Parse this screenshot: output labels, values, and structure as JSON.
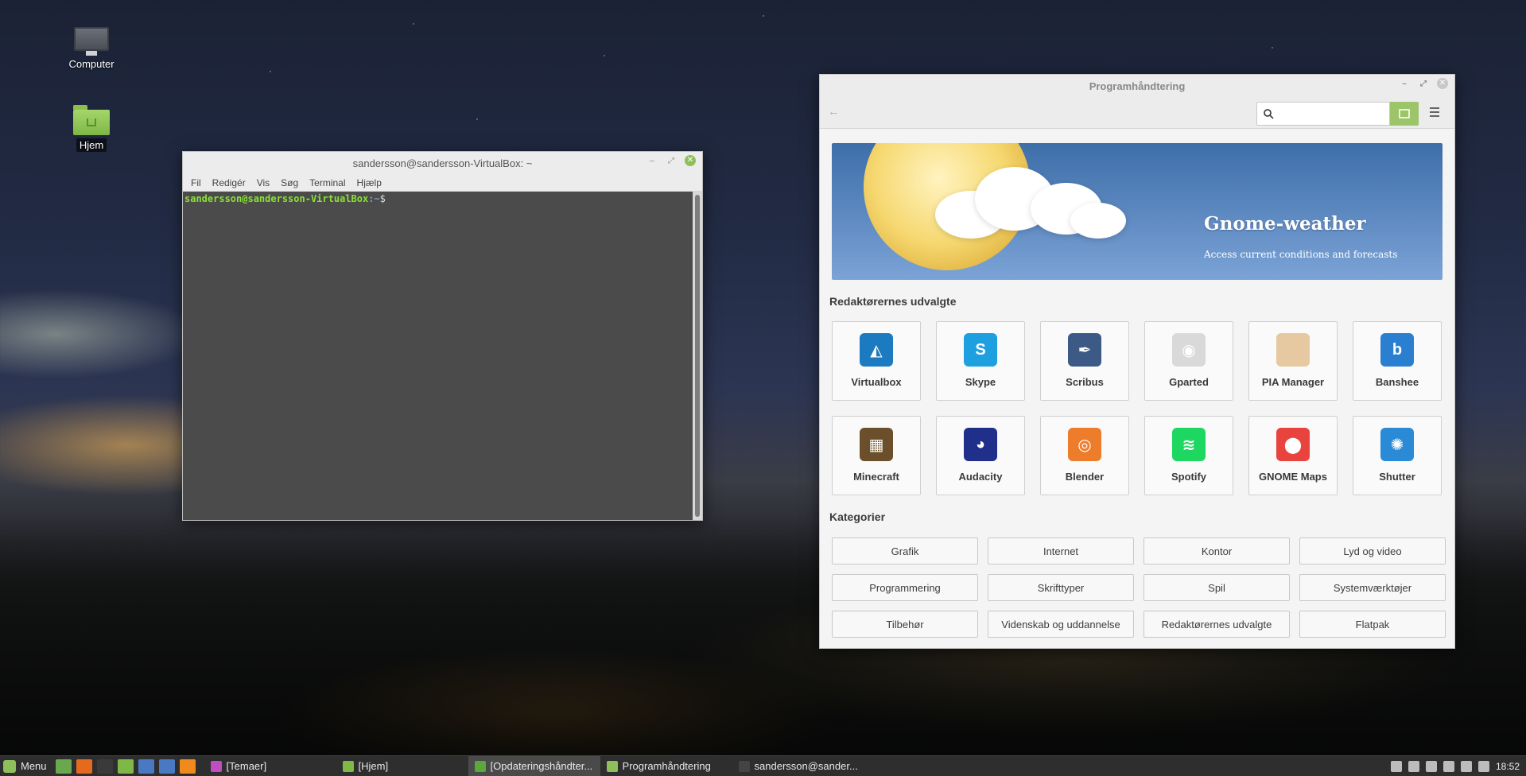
{
  "desktop": {
    "icons": [
      {
        "label": "Computer"
      },
      {
        "label": "Hjem"
      }
    ]
  },
  "terminal": {
    "title": "sandersson@sandersson-VirtualBox: ~",
    "menu": [
      "Fil",
      "Redigér",
      "Vis",
      "Søg",
      "Terminal",
      "Hjælp"
    ],
    "prompt_user": "sandersson@sandersson-VirtualBox",
    "prompt_path": ":~",
    "prompt_symbol": "$"
  },
  "swmgr": {
    "title": "Programhåndtering",
    "search_value": "",
    "banner": {
      "title": "Gnome-weather",
      "subtitle": "Access current conditions and forecasts"
    },
    "featured_title": "Redaktørernes udvalgte",
    "apps": [
      {
        "name": "Virtualbox",
        "color": "#1c7bc0",
        "glyph": "◭"
      },
      {
        "name": "Skype",
        "color": "#1ea0e0",
        "glyph": "S"
      },
      {
        "name": "Scribus",
        "color": "#3d5a87",
        "glyph": "✒"
      },
      {
        "name": "Gparted",
        "color": "#d9d9d9",
        "glyph": "◉"
      },
      {
        "name": "PIA Manager",
        "color": "#e6c9a0",
        "glyph": ""
      },
      {
        "name": "Banshee",
        "color": "#2b7fd1",
        "glyph": "b"
      },
      {
        "name": "Minecraft",
        "color": "#6b4f2a",
        "glyph": "▦"
      },
      {
        "name": "Audacity",
        "color": "#1f2f8a",
        "glyph": "◕"
      },
      {
        "name": "Blender",
        "color": "#ee7d2b",
        "glyph": "◎"
      },
      {
        "name": "Spotify",
        "color": "#1ed760",
        "glyph": "≋"
      },
      {
        "name": "GNOME Maps",
        "color": "#e8433d",
        "glyph": "⬤"
      },
      {
        "name": "Shutter",
        "color": "#2a8ad6",
        "glyph": "✺"
      }
    ],
    "categories_title": "Kategorier",
    "categories": [
      "Grafik",
      "Internet",
      "Kontor",
      "Lyd og video",
      "Programmering",
      "Skrifttyper",
      "Spil",
      "Systemværktøjer",
      "Tilbehør",
      "Videnskab og uddannelse",
      "Redaktørernes udvalgte",
      "Flatpak"
    ]
  },
  "taskbar": {
    "menu_label": "Menu",
    "launchers": [
      {
        "name": "desktop",
        "color": "#6aa84f"
      },
      {
        "name": "firefox",
        "color": "#e66a1d"
      },
      {
        "name": "terminal",
        "color": "#3a3a3a"
      },
      {
        "name": "files",
        "color": "#7fb846"
      },
      {
        "name": "mail",
        "color": "#4a79c4"
      },
      {
        "name": "screenshot",
        "color": "#4a79c4"
      },
      {
        "name": "media",
        "color": "#f08a1c"
      }
    ],
    "tasks": [
      {
        "label": "[Temaer]",
        "color": "#c04ec0",
        "active": false
      },
      {
        "label": "[Hjem]",
        "color": "#7fb846",
        "active": false
      },
      {
        "label": "[Opdateringshåndter...",
        "color": "#5aa83c",
        "active": true
      },
      {
        "label": "Programhåndtering",
        "color": "#8fbf5a",
        "active": false
      },
      {
        "label": "sandersson@sander...",
        "color": "#444444",
        "active": false
      }
    ],
    "clock": "18:52"
  }
}
